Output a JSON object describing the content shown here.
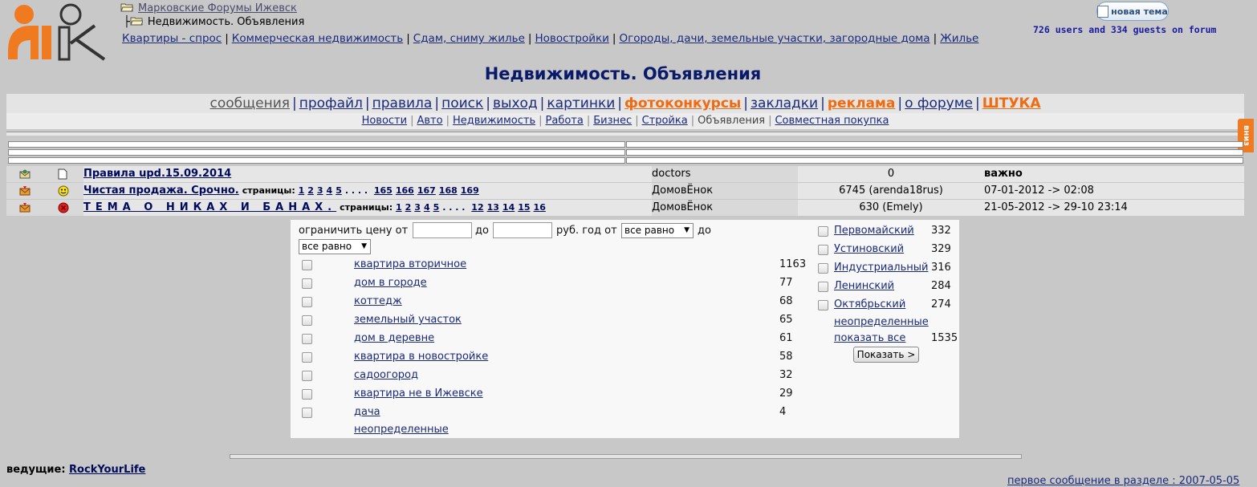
{
  "breadcrumb": {
    "root": "Марковские Форумы Ижевск",
    "current": "Недвижимость. Объявления"
  },
  "sublinks": [
    "Квартиры - спрос",
    "Коммерческая недвижимость",
    "Сдам, сниму жилье",
    "Новостройки",
    "Огороды, дачи, земельные участки, загородные дома",
    "Жилье"
  ],
  "new_topic_label": "новая тема",
  "online": "726 users and 334 guests on forum",
  "page_title": "Недвижимость. Объявления",
  "mainnav": [
    {
      "label": "сообщения",
      "style": "gray"
    },
    {
      "label": "профайл",
      "style": ""
    },
    {
      "label": "правила",
      "style": ""
    },
    {
      "label": "поиск",
      "style": ""
    },
    {
      "label": "выход",
      "style": ""
    },
    {
      "label": "картинки",
      "style": ""
    },
    {
      "label": "фотоконкурсы",
      "style": "orange"
    },
    {
      "label": "закладки",
      "style": ""
    },
    {
      "label": "реклама",
      "style": "orange"
    },
    {
      "label": "о форуме",
      "style": ""
    },
    {
      "label": "ШТУКА",
      "style": "orange"
    }
  ],
  "subnav": [
    {
      "label": "Новости",
      "current": false
    },
    {
      "label": "Авто",
      "current": false
    },
    {
      "label": "Недвижимость",
      "current": false
    },
    {
      "label": "Работа",
      "current": false
    },
    {
      "label": "Бизнес",
      "current": false
    },
    {
      "label": "Стройка",
      "current": false
    },
    {
      "label": "Объявления",
      "current": true
    },
    {
      "label": "Совместная покупка",
      "current": false
    }
  ],
  "vniz": "вниз",
  "topics": [
    {
      "icon": "pinned-envelope-icon",
      "status": "doc-icon",
      "title": "Правила upd.15.09.2014",
      "pages_label": "",
      "pages": [],
      "author": "doctors",
      "replies": "0",
      "last": "важно",
      "last_bold": true,
      "spaced": false
    },
    {
      "icon": "hot-envelope-icon",
      "status": "smiley-icon",
      "title": "Чистая продажа. Срочно.",
      "pages_label": "страницы:",
      "pages": [
        "1",
        "2",
        "3",
        "4",
        "5",
        ". . . .",
        "165",
        "166",
        "167",
        "168",
        "169"
      ],
      "author": "ДомовЁнок",
      "replies": "6745 (arenda18rus)",
      "last": "07-01-2012 -> 02:08",
      "last_bold": false,
      "spaced": false
    },
    {
      "icon": "hot-envelope-icon",
      "status": "red-x-icon",
      "title": "ТЕМА О НИКАХ И БАНАХ.",
      "pages_label": "страницы:",
      "pages": [
        "1",
        "2",
        "3",
        "4",
        "5",
        ". . . .",
        "12",
        "13",
        "14",
        "15",
        "16"
      ],
      "author": "ДомовЁнок",
      "replies": "630 (Emely)",
      "last": "21-05-2012 -> 29-10 23:14",
      "last_bold": false,
      "spaced": true
    }
  ],
  "filter": {
    "price_from": "ограничить цену от",
    "price_to": "до",
    "rub_year_from": "руб. год от",
    "year_to": "до",
    "any": "все равно",
    "categories": [
      {
        "label": "квартира вторичное",
        "count": "1163"
      },
      {
        "label": "дом в городе",
        "count": "77"
      },
      {
        "label": "коттедж",
        "count": "68"
      },
      {
        "label": "земельный участок",
        "count": "65"
      },
      {
        "label": "дом в деревне",
        "count": "61"
      },
      {
        "label": "квартира в новостройке",
        "count": "58"
      },
      {
        "label": "садоогород",
        "count": "32"
      },
      {
        "label": "квартира не в Ижевске",
        "count": "29"
      },
      {
        "label": "дача",
        "count": "4"
      }
    ],
    "categories_undefined": "неопределенные",
    "districts": [
      {
        "label": "Первомайский",
        "count": "332"
      },
      {
        "label": "Устиновский",
        "count": "329"
      },
      {
        "label": "Индустриальный",
        "count": "316"
      },
      {
        "label": "Ленинский",
        "count": "284"
      },
      {
        "label": "Октябрьский",
        "count": "274"
      }
    ],
    "districts_undefined": "неопределенные",
    "show_all": "показать все",
    "show_all_count": "1535",
    "show_button": "Показать >"
  },
  "moderator_label": "ведущие:",
  "moderator": "RockYourLife",
  "last_message": "первое сообщение в разделе : 2007-05-05"
}
